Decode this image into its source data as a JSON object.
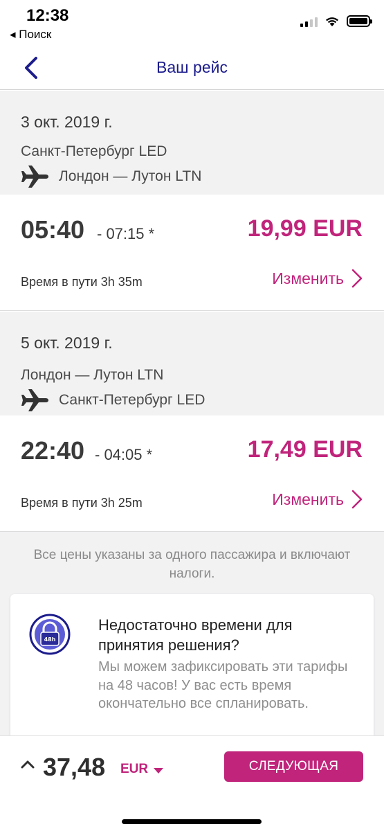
{
  "status_bar": {
    "time": "12:38",
    "back_app": "◂ Поиск"
  },
  "nav": {
    "title": "Ваш рейс"
  },
  "flights": [
    {
      "date": "3 окт. 2019 г.",
      "from": "Санкт-Петербург LED",
      "to": "Лондон — Лутон LTN",
      "departure": "05:40",
      "arrival": "- 07:15 *",
      "price": "19,99 EUR",
      "duration": "Время в пути 3h 35m",
      "change_label": "Изменить"
    },
    {
      "date": "5 окт. 2019 г.",
      "from": "Лондон — Лутон LTN",
      "to": "Санкт-Петербург LED",
      "departure": "22:40",
      "arrival": "- 04:05 *",
      "price": "17,49 EUR",
      "duration": "Время в пути 3h 25m",
      "change_label": "Изменить"
    }
  ],
  "price_note": "Все цены указаны за одного пассажира и включают налоги.",
  "hold_offer": {
    "badge": "48h",
    "title": "Недостаточно времени для принятия решения?",
    "description": "Мы можем зафиксировать эти тарифы на 48 часов! У вас есть время окончательно все спланировать."
  },
  "footer": {
    "total": "37,48",
    "currency": "EUR",
    "next_button": "СЛЕДУЮЩАЯ"
  },
  "colors": {
    "accent": "#c0247b",
    "nav_title": "#1c1c8c",
    "grey_bg": "#f2f2f3"
  },
  "icons": [
    "chevron-left-icon",
    "plane-icon",
    "chevron-right-icon",
    "lock-48h-icon",
    "caret-up-icon",
    "caret-down-icon",
    "signal-icon",
    "wifi-icon",
    "battery-icon"
  ]
}
